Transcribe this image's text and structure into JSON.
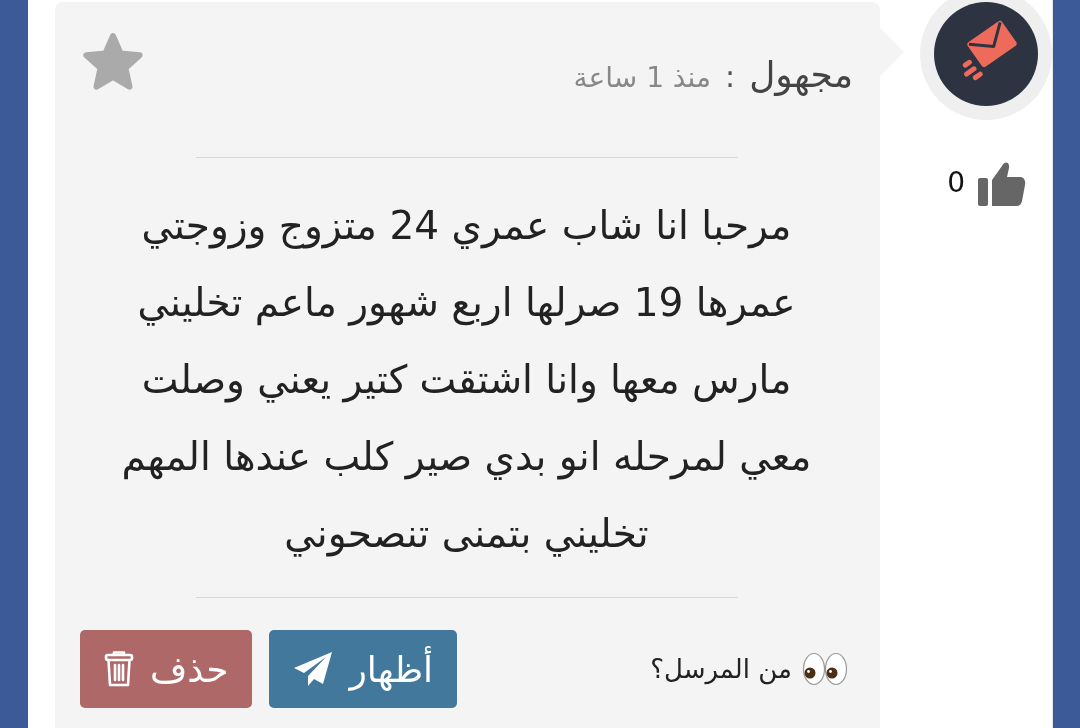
{
  "author": {
    "name": "مجهول",
    "separator": ":",
    "time": "منذ 1 ساعة"
  },
  "favorite": false,
  "likes": {
    "count": "0"
  },
  "message": {
    "text": "مرحبا انا شاب عمري 24 متزوج وزوجتي\nعمرها 19 صرلها اربع شهور ماعم تخليني\nمارس معها وانا اشتقت كتير يعني وصلت\nمعي لمرحله انو بدي صير كلب عندها المهم\nتخليني بتمنى تنصحوني"
  },
  "sender_prompt": "من المرسل؟",
  "buttons": [
    {
      "kind": "reveal",
      "label": "أظهار"
    },
    {
      "kind": "delete",
      "label": "حذف"
    }
  ]
}
